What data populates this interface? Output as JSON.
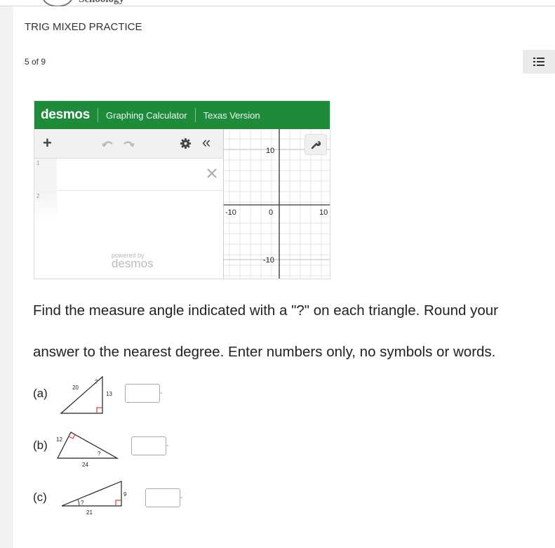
{
  "branding": {
    "logo_text": "Schoology"
  },
  "assessment": {
    "title": "TRIG MIXED PRACTICE",
    "progress": "5 of 9"
  },
  "desmos": {
    "logo": "desmos",
    "header_items": [
      "Graphing Calculator",
      "Texas Version"
    ],
    "expression_rows": [
      "1",
      "2"
    ],
    "powered_by": "powered by",
    "powered_logo": "desmos",
    "axis_labels": {
      "y_top": "10",
      "y_bottom": "-10",
      "x_left": "-10",
      "x_origin": "0",
      "x_right": "10"
    }
  },
  "instructions": "Find the measure angle indicated with a \"?\" on each triangle.  Round your answer to the nearest degree.  Enter numbers only, no symbols or words.",
  "problems": [
    {
      "label": "(a)",
      "hyp": "20",
      "side": "13",
      "q": "?"
    },
    {
      "label": "(b)",
      "side_a": "12",
      "side_b": "24",
      "q": "?"
    },
    {
      "label": "(c)",
      "side_a": "9",
      "side_b": "21",
      "q": "?"
    }
  ],
  "icons": {
    "list": "question-list-icon",
    "wrench": "wrench-icon",
    "settings": "gear-icon",
    "collapse": "collapse-icon",
    "add": "plus-icon",
    "undo": "undo-icon",
    "redo": "redo-icon",
    "delete": "close-icon"
  },
  "colors": {
    "desmos_green": "#1e8b3a",
    "right_angle": "#e03c31"
  }
}
